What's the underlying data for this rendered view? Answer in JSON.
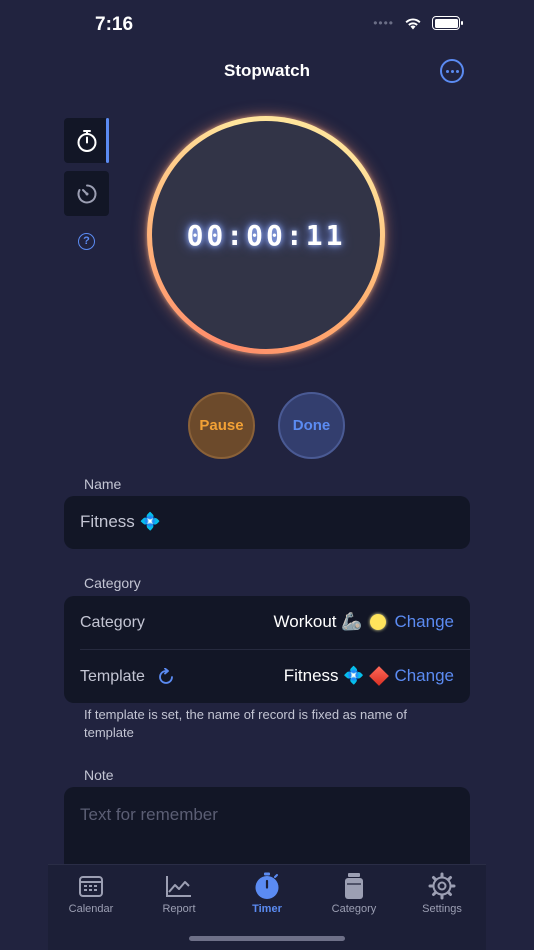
{
  "status": {
    "time": "7:16",
    "signal": "••••"
  },
  "nav": {
    "title": "Stopwatch"
  },
  "timer": {
    "display": "00:00:11"
  },
  "controls": {
    "pause_label": "Pause",
    "done_label": "Done"
  },
  "name_section": {
    "label": "Name",
    "value": "Fitness 💠"
  },
  "category_section": {
    "label": "Category",
    "category_row": {
      "label": "Category",
      "value": "Workout 🦾",
      "change": "Change"
    },
    "template_row": {
      "label": "Template",
      "value": "Fitness 💠",
      "change": "Change"
    },
    "hint": "If template is set, the name of record is fixed as name of template"
  },
  "note_section": {
    "label": "Note",
    "placeholder": "Text for remember"
  },
  "tabs": [
    {
      "label": "Calendar",
      "icon": "calendar-icon"
    },
    {
      "label": "Report",
      "icon": "chart-icon"
    },
    {
      "label": "Timer",
      "icon": "timer-icon",
      "active": true
    },
    {
      "label": "Category",
      "icon": "jar-icon"
    },
    {
      "label": "Settings",
      "icon": "gear-icon"
    }
  ],
  "colors": {
    "accent": "#5b8bf2",
    "background": "#21233f",
    "card": "#121626",
    "pause": "#f2a135"
  }
}
